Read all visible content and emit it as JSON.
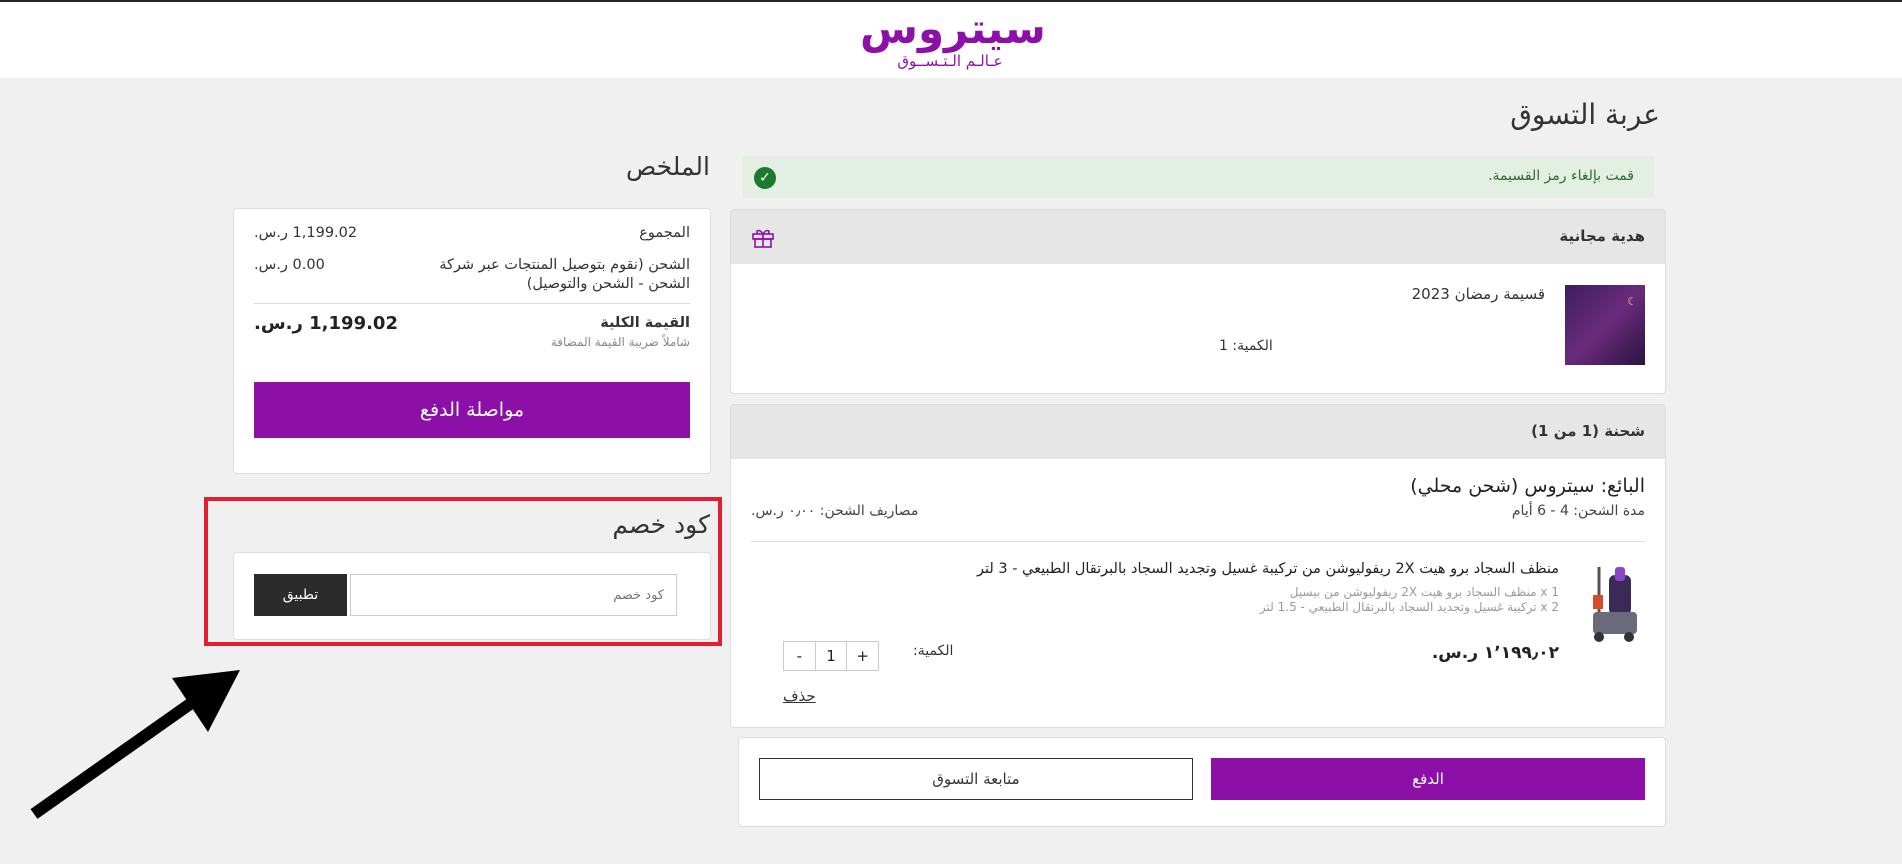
{
  "logo": {
    "main": "سيتروس",
    "sub": "عـالـم الـتـســوق",
    "color": "#8c0fa8"
  },
  "cart": {
    "title": "عربة التسوق",
    "alert": "قمت بإلغاء رمز القسيمة.",
    "gift": {
      "header": "هدية مجانية",
      "icon": "gift-icon",
      "name": "قسيمة رمضان 2023",
      "qty": "الكمية: 1"
    },
    "shipment": {
      "header": "شحنة (1 من 1)",
      "seller": "البائع: سيتروس (شحن محلي)",
      "duration": "مدة الشحن: 4 - 6 أيام",
      "cost": "مصاريف الشحن: ٠٫٠٠ ر.س.",
      "product": {
        "title": "منظف السجاد برو هيت 2X ريفوليوشن من تركيبة غسيل وتجديد السجاد بالبرتقال الطبيعي - 3 لتر",
        "sub1": "1 x منظف السجاد برو هيت 2X ريفوليوشن من بيسيل",
        "sub2": "2 x تركيبة غسيل وتجديد السجاد بالبرتقال الطبيعي - 1.5 لتر",
        "price": "١٬١٩٩٫٠٢ ر.س.",
        "qty_label": "الكمية:",
        "qty": "1",
        "plus": "+",
        "minus": "-",
        "delete": "حذف"
      }
    },
    "actions": {
      "pay": "الدفع",
      "continue": "متابعة التسوق"
    }
  },
  "summary": {
    "title": "الملخص",
    "subtotal_label": "المجموع",
    "subtotal_value": "1,199.02 ر.س.",
    "shipping_label_1": "الشحن (نقوم بتوصيل المنتجات عبر شركة",
    "shipping_label_2": "الشحن - الشحن والتوصيل)",
    "shipping_value": "0.00 ر.س.",
    "total_label": "القيمة الكلية",
    "vat_note": "شاملاً ضريبة القيمة المضافة",
    "total_value": "1,199.02 ر.س.",
    "checkout": "مواصلة الدفع"
  },
  "coupon": {
    "title": "كود خصم",
    "placeholder": "كود خصم",
    "apply": "تطبيق"
  },
  "colors": {
    "brand": "#8c0fa8",
    "highlight": "#e0202e",
    "success": "#1b7a2e"
  }
}
